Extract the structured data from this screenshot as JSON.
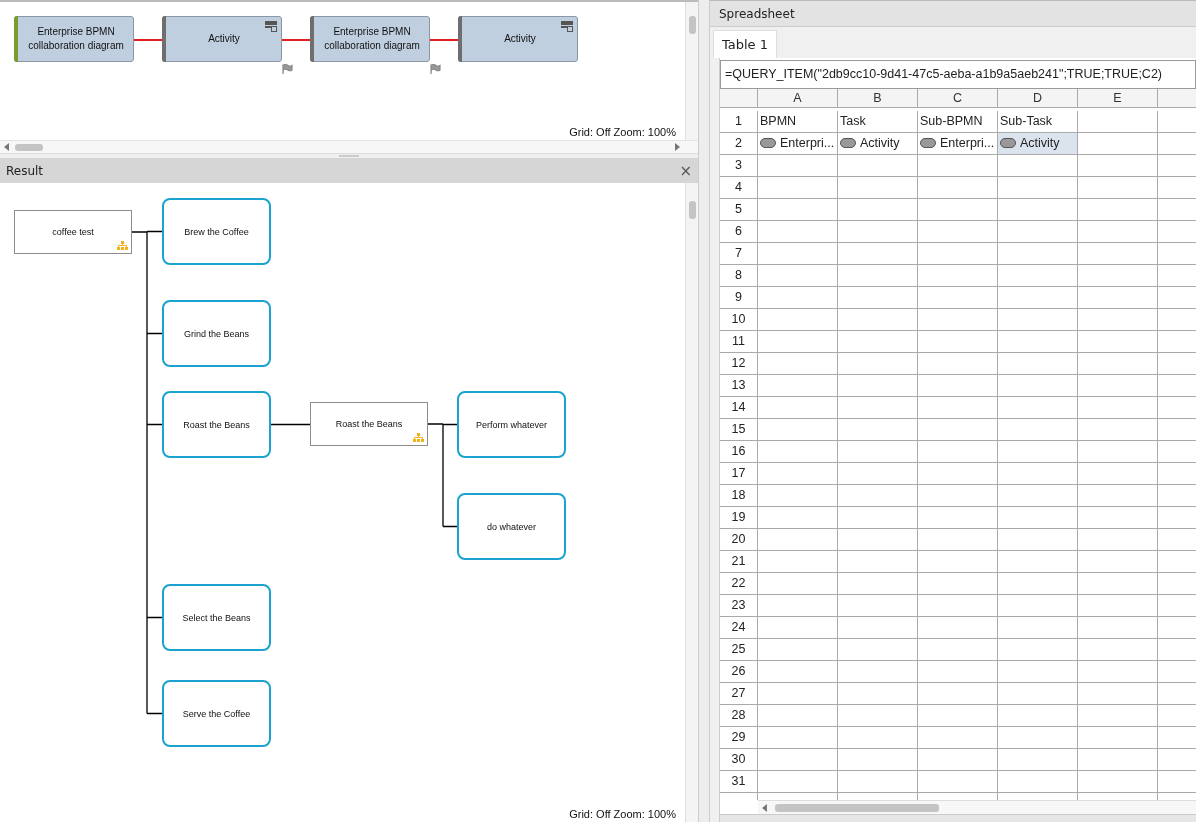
{
  "top_diagram": {
    "nodes": [
      {
        "kind": "collaboration",
        "label": "Enterprise BPMN collaboration diagram",
        "color": "#7a9c2c",
        "marker": false
      },
      {
        "kind": "activity",
        "label": "Activity",
        "color": "#6e6e6e",
        "marker": true
      },
      {
        "kind": "collaboration",
        "label": "Enterprise BPMN collaboration diagram",
        "color": "#6e6e6e",
        "marker": true
      },
      {
        "kind": "activity",
        "label": "Activity",
        "color": "#6e6e6e",
        "marker": false
      }
    ],
    "status": "Grid: Off  Zoom: 100%"
  },
  "result": {
    "title": "Result",
    "close": "×",
    "tree": {
      "kind": "diagram",
      "label": "coffee test",
      "children": [
        {
          "kind": "task",
          "label": "Brew the Coffee"
        },
        {
          "kind": "task",
          "label": "Grind the Beans"
        },
        {
          "kind": "task",
          "label": "Roast the Beans",
          "children": [
            {
              "kind": "diagram",
              "label": "Roast the Beans",
              "children": [
                {
                  "kind": "task",
                  "label": "Perform whatever"
                },
                {
                  "kind": "task",
                  "label": "do whatever"
                }
              ]
            }
          ]
        },
        {
          "kind": "task",
          "label": "Select the Beans"
        },
        {
          "kind": "task",
          "label": "Serve the Coffee"
        }
      ]
    },
    "status": "Grid: Off  Zoom: 100%"
  },
  "spreadsheet": {
    "title": "Spreadsheet",
    "tabs": [
      {
        "label": "Table 1",
        "selected": true
      }
    ],
    "formula": "=QUERY_ITEM(\"2db9cc10-9d41-47c5-aeba-a1b9a5aeb241\";TRUE;TRUE;C2)",
    "columns": [
      "A",
      "B",
      "C",
      "D",
      "E"
    ],
    "rows": [
      {
        "number": "1",
        "cells": [
          {
            "kind": "text",
            "text": "BPMN",
            "selected": false
          },
          {
            "kind": "text",
            "text": "Task",
            "selected": false
          },
          {
            "kind": "text",
            "text": "Sub-BPMN",
            "selected": false
          },
          {
            "kind": "text",
            "text": "Sub-Task",
            "selected": false
          }
        ]
      },
      {
        "number": "2",
        "cells": [
          {
            "kind": "item",
            "text": "Enterpri...",
            "selected": false
          },
          {
            "kind": "item",
            "text": "Activity",
            "selected": false
          },
          {
            "kind": "item",
            "text": "Enterpri...",
            "selected": false
          },
          {
            "kind": "item",
            "text": "Activity",
            "selected": true
          }
        ]
      },
      {
        "number": "3"
      },
      {
        "number": "4"
      },
      {
        "number": "5"
      },
      {
        "number": "6"
      },
      {
        "number": "7"
      },
      {
        "number": "8"
      },
      {
        "number": "9"
      },
      {
        "number": "10"
      },
      {
        "number": "11"
      },
      {
        "number": "12"
      },
      {
        "number": "13"
      },
      {
        "number": "14"
      },
      {
        "number": "15"
      },
      {
        "number": "16"
      },
      {
        "number": "17"
      },
      {
        "number": "18"
      },
      {
        "number": "19"
      },
      {
        "number": "20"
      },
      {
        "number": "21"
      },
      {
        "number": "22"
      },
      {
        "number": "23"
      },
      {
        "number": "24"
      },
      {
        "number": "25"
      },
      {
        "number": "26"
      },
      {
        "number": "27"
      },
      {
        "number": "28"
      },
      {
        "number": "29"
      },
      {
        "number": "30"
      },
      {
        "number": "31"
      }
    ]
  }
}
